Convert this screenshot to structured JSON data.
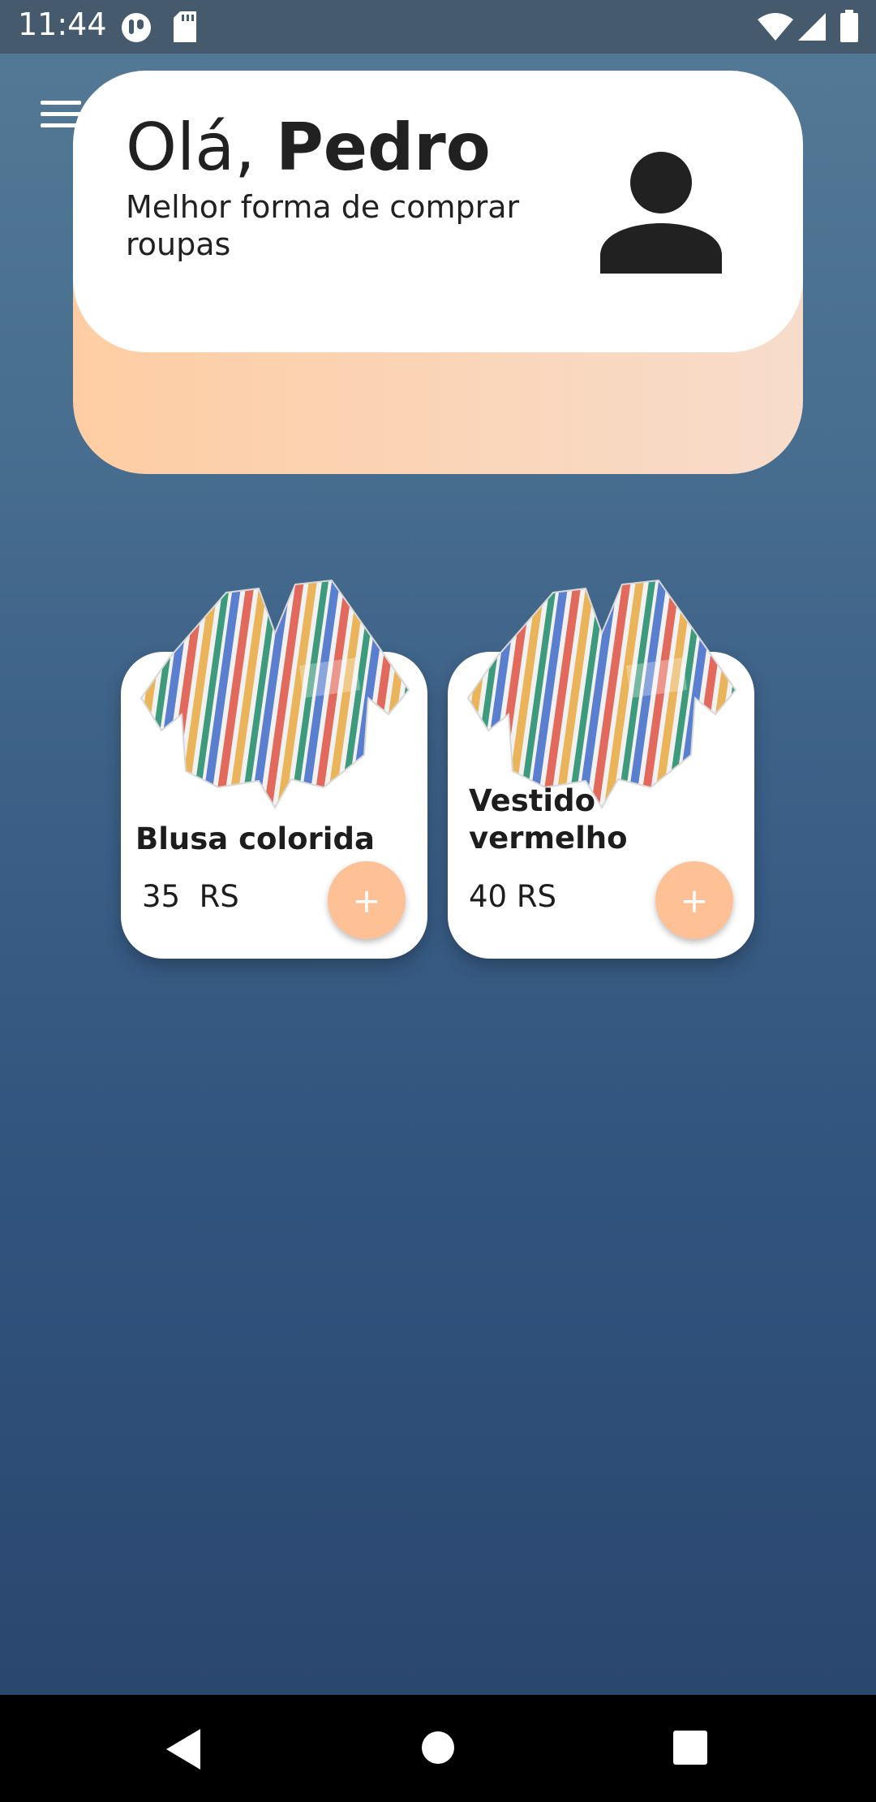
{
  "status_bar": {
    "time": "11:44"
  },
  "header": {
    "greeting": "Olá,",
    "name": "Pedro",
    "subtitle": "Melhor forma de comprar roupas"
  },
  "products": [
    {
      "name": "Blusa colorida",
      "price": "35  RS",
      "add_label": "+"
    },
    {
      "name": "Vestido vermelho",
      "price": "40 RS",
      "add_label": "+"
    }
  ],
  "colors": {
    "accent": "#fec196",
    "peach_start": "#fecda3",
    "peach_end": "#f7dccb",
    "background_top": "#557a96",
    "background_bottom": "#29446c",
    "status_bar": "#455a6c"
  },
  "icons": [
    "menu-icon",
    "user-avatar-icon",
    "wifi-icon",
    "signal-icon",
    "battery-icon",
    "back-icon",
    "home-icon",
    "recents-icon"
  ]
}
